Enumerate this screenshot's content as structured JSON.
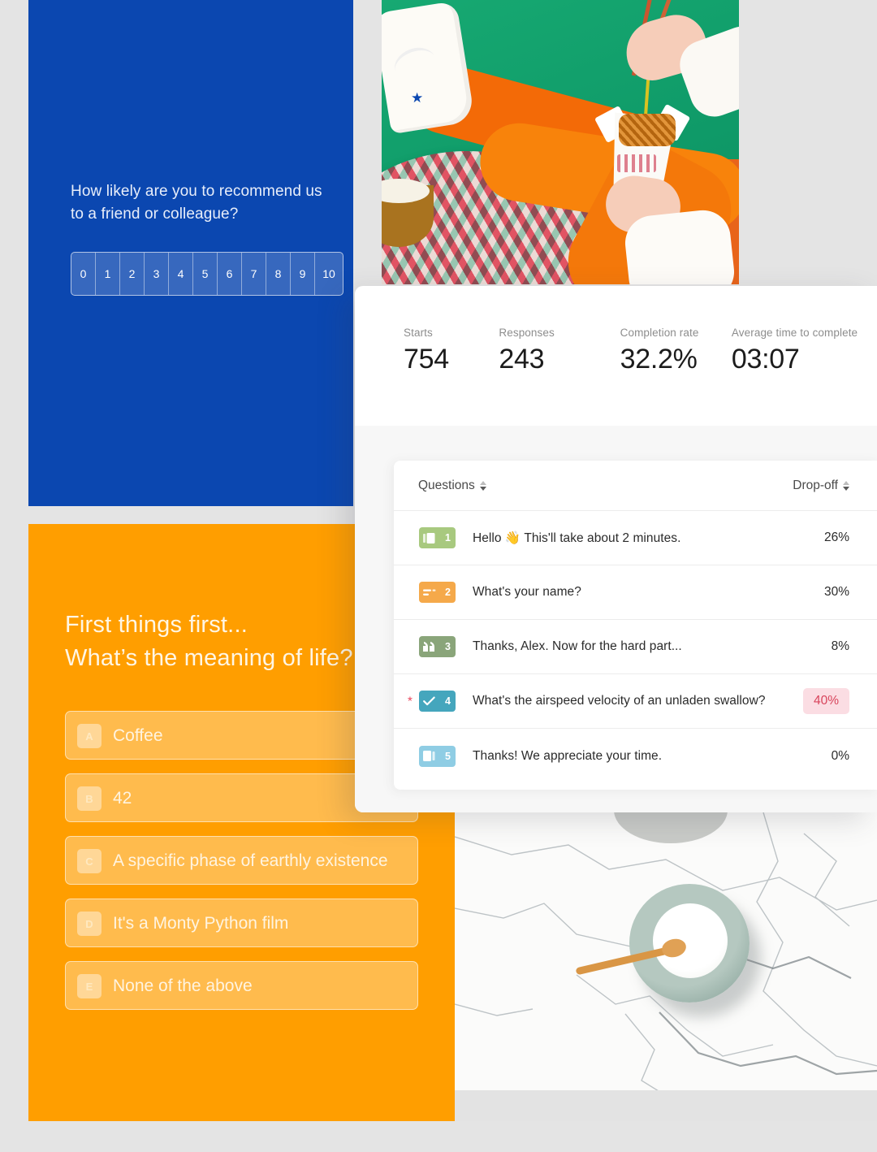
{
  "theme": {
    "page_bg": "#e4e4e4",
    "nps_blue": "#0b47b0",
    "quiz_orange": "#ff9e00",
    "photo_green": "#14a06e",
    "flag_pink_bg": "#fbdde3",
    "flag_pink_text": "#d8455c"
  },
  "nps_card": {
    "question": "How likely are you to recommend us to a friend or colleague?",
    "scale": [
      "0",
      "1",
      "2",
      "3",
      "4",
      "5",
      "6",
      "7",
      "8",
      "9",
      "10"
    ]
  },
  "quiz_card": {
    "title_line1": "First things first...",
    "title_line2": "What’s the meaning of life?",
    "options": [
      {
        "key": "A",
        "text": "Coffee"
      },
      {
        "key": "B",
        "text": "42"
      },
      {
        "key": "C",
        "text": "A specific phase of earthly existence"
      },
      {
        "key": "D",
        "text": "It's a Monty Python film"
      },
      {
        "key": "E",
        "text": "None of the above"
      }
    ]
  },
  "analytics": {
    "stats": [
      {
        "label": "Starts",
        "value": "754"
      },
      {
        "label": "Responses",
        "value": "243"
      },
      {
        "label": "Completion rate",
        "value": "32.2%"
      },
      {
        "label": "Average time to complete",
        "value": "03:07"
      }
    ],
    "table": {
      "columns": {
        "questions": "Questions",
        "dropoff": "Drop-off"
      },
      "rows": [
        {
          "number": "1",
          "icon": "welcome-card-icon",
          "badge_color": "#a8c97f",
          "text": "Hello 👋  This'll take about 2 minutes.",
          "dropoff": "26%",
          "flagged": false,
          "required": false
        },
        {
          "number": "2",
          "icon": "short-text-icon",
          "badge_color": "#f5a94a",
          "text": "What's your name?",
          "dropoff": "30%",
          "flagged": false,
          "required": false
        },
        {
          "number": "3",
          "icon": "quote-icon",
          "badge_color": "#8aa57a",
          "text": "Thanks, Alex. Now for the hard part...",
          "dropoff": "8%",
          "flagged": false,
          "required": false
        },
        {
          "number": "4",
          "icon": "checkmark-icon",
          "badge_color": "#45a6bd",
          "text": "What's the airspeed velocity of an unladen swallow?",
          "dropoff": "40%",
          "flagged": true,
          "required": true
        },
        {
          "number": "5",
          "icon": "ending-card-icon",
          "badge_color": "#8fcde4",
          "text": "Thanks! We appreciate your time.",
          "dropoff": "0%",
          "flagged": false,
          "required": false
        }
      ]
    }
  }
}
